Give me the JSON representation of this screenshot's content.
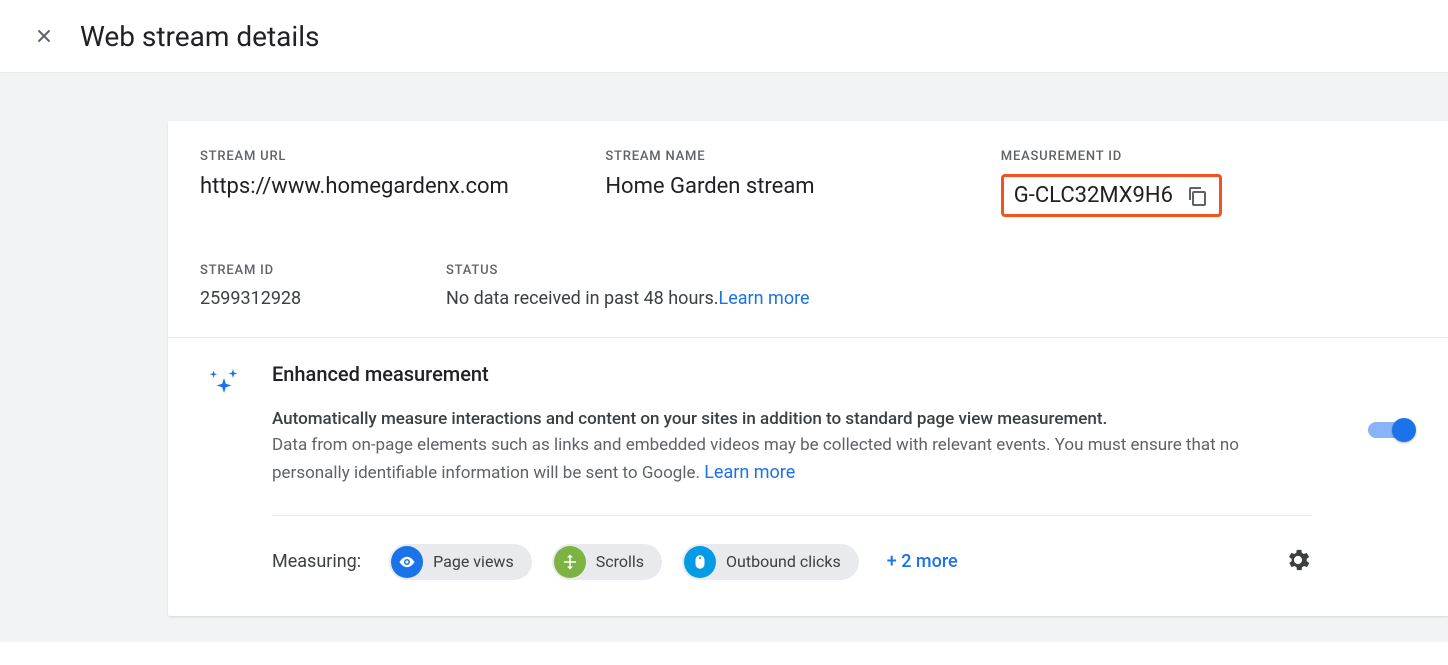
{
  "header": {
    "title": "Web stream details"
  },
  "stream": {
    "url_label": "STREAM URL",
    "url_value": "https://www.homegardenx.com",
    "name_label": "STREAM NAME",
    "name_value": "Home Garden stream",
    "mid_label": "MEASUREMENT ID",
    "mid_value": "G-CLC32MX9H6",
    "id_label": "STREAM ID",
    "id_value": "2599312928",
    "status_label": "STATUS",
    "status_value": "No data received in past 48 hours.",
    "status_link": "Learn more"
  },
  "enhanced": {
    "title": "Enhanced measurement",
    "desc_strong": "Automatically measure interactions and content on your sites in addition to standard page view measurement.",
    "desc_rest": "Data from on-page elements such as links and embedded videos may be collected with relevant events. You must ensure that no personally identifiable information will be sent to Google.",
    "desc_link": "Learn more",
    "measuring_label": "Measuring:",
    "chips": [
      {
        "label": "Page views",
        "color": "#1a73e8",
        "icon": "eye"
      },
      {
        "label": "Scrolls",
        "color": "#7cb342",
        "icon": "scroll"
      },
      {
        "label": "Outbound clicks",
        "color": "#039be5",
        "icon": "mouse"
      }
    ],
    "more_label": "+ 2 more"
  }
}
